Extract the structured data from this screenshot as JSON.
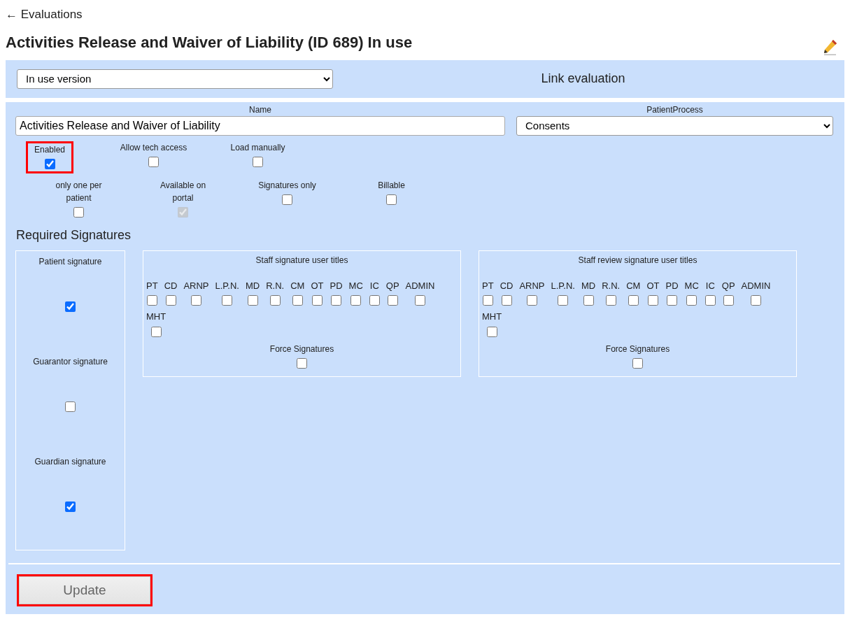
{
  "back_link": "← Evaluations",
  "title": "Activities Release and Waiver of Liability (ID 689) In use",
  "version_select": {
    "value": "In use version"
  },
  "link_evaluation": "Link evaluation",
  "name_field": {
    "label": "Name",
    "value": "Activities Release and Waiver of Liability"
  },
  "patient_process": {
    "label": "PatientProcess",
    "value": "Consents"
  },
  "options": [
    [
      {
        "label": "Enabled",
        "checked": true,
        "disabled": false,
        "highlighted": true
      },
      {
        "label": "Allow tech access",
        "checked": false,
        "disabled": false,
        "highlighted": false
      },
      {
        "label": "Load manually",
        "checked": false,
        "disabled": false,
        "highlighted": false
      }
    ],
    [
      {
        "label": "only one per patient",
        "checked": false,
        "disabled": false,
        "highlighted": false
      },
      {
        "label": "Available on portal",
        "checked": true,
        "disabled": true,
        "highlighted": false
      },
      {
        "label": "Signatures only",
        "checked": false,
        "disabled": false,
        "highlighted": false
      },
      {
        "label": "Billable",
        "checked": false,
        "disabled": false,
        "highlighted": false
      }
    ]
  ],
  "required_signatures": {
    "title": "Required Signatures",
    "signers": [
      {
        "label": "Patient signature",
        "checked": true
      },
      {
        "label": "Guarantor signature",
        "checked": false
      },
      {
        "label": "Guardian signature",
        "checked": true
      }
    ],
    "groups": [
      {
        "title": "Staff signature user titles",
        "titles": [
          {
            "label": "PT",
            "checked": false
          },
          {
            "label": "CD",
            "checked": false
          },
          {
            "label": "ARNP",
            "checked": false
          },
          {
            "label": "L.P.N.",
            "checked": false
          },
          {
            "label": "MD",
            "checked": false
          },
          {
            "label": "R.N.",
            "checked": false
          },
          {
            "label": "CM",
            "checked": false
          },
          {
            "label": "OT",
            "checked": false
          },
          {
            "label": "PD",
            "checked": false
          },
          {
            "label": "MC",
            "checked": false
          },
          {
            "label": "IC",
            "checked": false
          },
          {
            "label": "QP",
            "checked": false
          },
          {
            "label": "ADMIN",
            "checked": false
          },
          {
            "label": "MHT",
            "checked": false
          }
        ],
        "force": {
          "label": "Force Signatures",
          "checked": false
        }
      },
      {
        "title": "Staff review signature user titles",
        "titles": [
          {
            "label": "PT",
            "checked": false
          },
          {
            "label": "CD",
            "checked": false
          },
          {
            "label": "ARNP",
            "checked": false
          },
          {
            "label": "L.P.N.",
            "checked": false
          },
          {
            "label": "MD",
            "checked": false
          },
          {
            "label": "R.N.",
            "checked": false
          },
          {
            "label": "CM",
            "checked": false
          },
          {
            "label": "OT",
            "checked": false
          },
          {
            "label": "PD",
            "checked": false
          },
          {
            "label": "MC",
            "checked": false
          },
          {
            "label": "IC",
            "checked": false
          },
          {
            "label": "QP",
            "checked": false
          },
          {
            "label": "ADMIN",
            "checked": false
          },
          {
            "label": "MHT",
            "checked": false
          }
        ],
        "force": {
          "label": "Force Signatures",
          "checked": false
        }
      }
    ]
  },
  "update_button": {
    "label": "Update",
    "highlighted": true
  }
}
